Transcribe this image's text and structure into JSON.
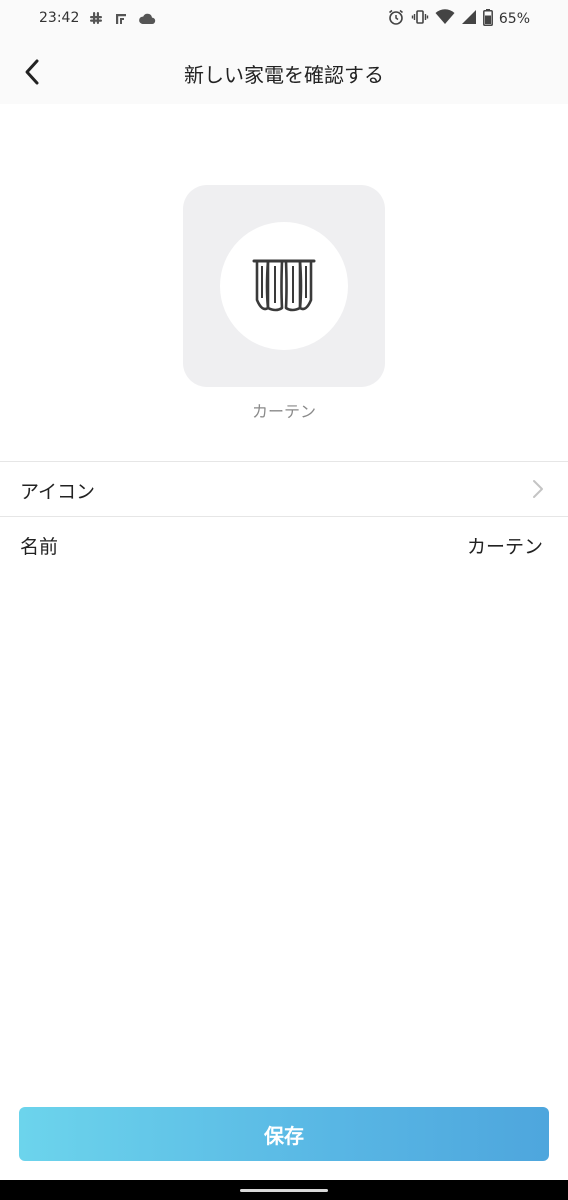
{
  "status_bar": {
    "time": "23:42",
    "battery_percent": "65%",
    "left_icons": [
      "slack-icon",
      "f-app-icon",
      "cloud-icon"
    ],
    "right_icons": [
      "alarm-icon",
      "vibrate-icon",
      "wifi-icon",
      "signal-icon",
      "battery-icon"
    ]
  },
  "header": {
    "title": "新しい家電を確認する",
    "back_icon": "chevron-left-icon"
  },
  "device": {
    "icon": "curtain-icon",
    "name": "カーテン"
  },
  "settings": {
    "icon_row": {
      "label": "アイコン",
      "chevron": "chevron-right-icon"
    },
    "name_row": {
      "label": "名前",
      "value": "カーテン"
    }
  },
  "footer": {
    "save_label": "保存"
  },
  "colors": {
    "save_gradient_start": "#6cd4ec",
    "save_gradient_end": "#4ea6dd",
    "tile_background": "#efeff1",
    "divider": "#e6e6e6"
  }
}
